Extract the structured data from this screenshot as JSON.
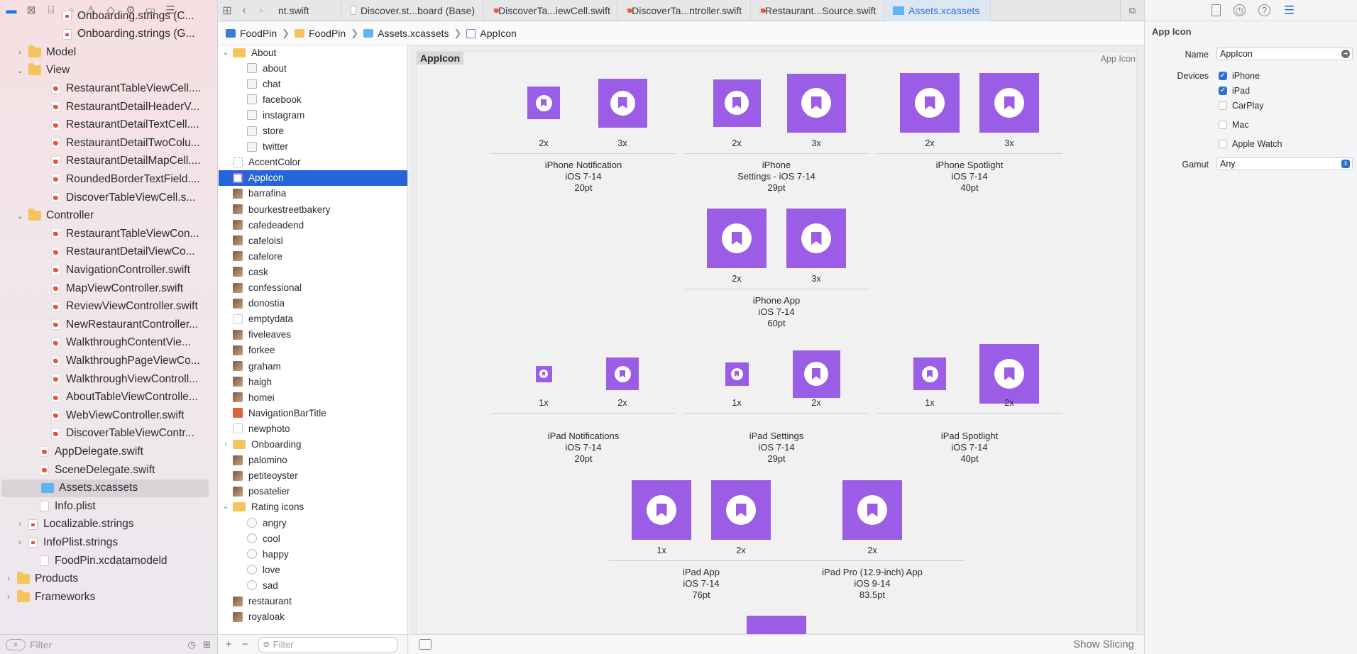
{
  "navigator": {
    "toolbar_icons": [
      "folder-icon",
      "source-control-icon",
      "symbol-icon",
      "find-icon",
      "issue-icon",
      "test-icon",
      "debug-icon",
      "breakpoint-icon",
      "report-icon"
    ],
    "items": [
      {
        "label": "Onboarding.strings (C...",
        "indent": 5,
        "kind": "strings",
        "disclosure": ""
      },
      {
        "label": "Onboarding.strings (G...",
        "indent": 5,
        "kind": "strings",
        "disclosure": ""
      },
      {
        "label": "Model",
        "indent": 2,
        "kind": "folder",
        "disclosure": "›"
      },
      {
        "label": "View",
        "indent": 2,
        "kind": "folder",
        "disclosure": "⌄"
      },
      {
        "label": "RestaurantTableViewCell....",
        "indent": 4,
        "kind": "swift",
        "disclosure": ""
      },
      {
        "label": "RestaurantDetailHeaderV...",
        "indent": 4,
        "kind": "swift",
        "disclosure": ""
      },
      {
        "label": "RestaurantDetailTextCell....",
        "indent": 4,
        "kind": "swift",
        "disclosure": ""
      },
      {
        "label": "RestaurantDetailTwoColu...",
        "indent": 4,
        "kind": "swift",
        "disclosure": ""
      },
      {
        "label": "RestaurantDetailMapCell....",
        "indent": 4,
        "kind": "swift",
        "disclosure": ""
      },
      {
        "label": "RoundedBorderTextField....",
        "indent": 4,
        "kind": "swift",
        "disclosure": ""
      },
      {
        "label": "DiscoverTableViewCell.s...",
        "indent": 4,
        "kind": "swift",
        "disclosure": ""
      },
      {
        "label": "Controller",
        "indent": 2,
        "kind": "folder",
        "disclosure": "⌄"
      },
      {
        "label": "RestaurantTableViewCon...",
        "indent": 4,
        "kind": "swift",
        "disclosure": ""
      },
      {
        "label": "RestaurantDetailViewCo...",
        "indent": 4,
        "kind": "swift",
        "disclosure": ""
      },
      {
        "label": "NavigationController.swift",
        "indent": 4,
        "kind": "swift",
        "disclosure": ""
      },
      {
        "label": "MapViewController.swift",
        "indent": 4,
        "kind": "swift",
        "disclosure": ""
      },
      {
        "label": "ReviewViewController.swift",
        "indent": 4,
        "kind": "swift",
        "disclosure": ""
      },
      {
        "label": "NewRestaurantController...",
        "indent": 4,
        "kind": "swift",
        "disclosure": ""
      },
      {
        "label": "WalkthroughContentVie...",
        "indent": 4,
        "kind": "swift",
        "disclosure": ""
      },
      {
        "label": "WalkthroughPageViewCo...",
        "indent": 4,
        "kind": "swift",
        "disclosure": ""
      },
      {
        "label": "WalkthroughViewControll...",
        "indent": 4,
        "kind": "swift",
        "disclosure": ""
      },
      {
        "label": "AboutTableViewControlle...",
        "indent": 4,
        "kind": "swift",
        "disclosure": ""
      },
      {
        "label": "WebViewController.swift",
        "indent": 4,
        "kind": "swift",
        "disclosure": ""
      },
      {
        "label": "DiscoverTableViewContr...",
        "indent": 4,
        "kind": "swift",
        "disclosure": ""
      },
      {
        "label": "AppDelegate.swift",
        "indent": 3,
        "kind": "swift",
        "disclosure": ""
      },
      {
        "label": "SceneDelegate.swift",
        "indent": 3,
        "kind": "swift",
        "disclosure": ""
      },
      {
        "label": "Assets.xcassets",
        "indent": 3,
        "kind": "assets",
        "disclosure": "",
        "selected": true
      },
      {
        "label": "Info.plist",
        "indent": 3,
        "kind": "plist",
        "disclosure": ""
      },
      {
        "label": "Localizable.strings",
        "indent": 2,
        "kind": "strings",
        "disclosure": "›"
      },
      {
        "label": "InfoPlist.strings",
        "indent": 2,
        "kind": "strings",
        "disclosure": "›"
      },
      {
        "label": "FoodPin.xcdatamodeld",
        "indent": 3,
        "kind": "plist",
        "disclosure": ""
      },
      {
        "label": "Products",
        "indent": 1,
        "kind": "folder",
        "disclosure": "›"
      },
      {
        "label": "Frameworks",
        "indent": 1,
        "kind": "folder",
        "disclosure": "›"
      }
    ],
    "filter_placeholder": "Filter"
  },
  "tabs": {
    "items": [
      {
        "label": "nt.swift",
        "kind": "swift",
        "active": false
      },
      {
        "label": "Discover.st...board (Base)",
        "kind": "storyboard",
        "active": false
      },
      {
        "label": "DiscoverTa...iewCell.swift",
        "kind": "swift",
        "active": false
      },
      {
        "label": "DiscoverTa...ntroller.swift",
        "kind": "swift",
        "active": false
      },
      {
        "label": "Restaurant...Source.swift",
        "kind": "swift",
        "active": false
      },
      {
        "label": "Assets.xcassets",
        "kind": "assets",
        "active": true
      }
    ]
  },
  "jumpbar": {
    "crumbs": [
      "FoodPin",
      "FoodPin",
      "Assets.xcassets",
      "AppIcon"
    ]
  },
  "asset_list": {
    "items": [
      {
        "label": "About",
        "level": 0,
        "thumb": "folder",
        "disclosure": "⌄"
      },
      {
        "label": "about",
        "level": 1,
        "thumb": "set"
      },
      {
        "label": "chat",
        "level": 1,
        "thumb": "set"
      },
      {
        "label": "facebook",
        "level": 1,
        "thumb": "set"
      },
      {
        "label": "instagram",
        "level": 1,
        "thumb": "set"
      },
      {
        "label": "store",
        "level": 1,
        "thumb": "set"
      },
      {
        "label": "twitter",
        "level": 1,
        "thumb": "set"
      },
      {
        "label": "AccentColor",
        "level": 0,
        "thumb": "color"
      },
      {
        "label": "AppIcon",
        "level": 0,
        "thumb": "app",
        "selected": true
      },
      {
        "label": "barrafina",
        "level": 0,
        "thumb": "photo"
      },
      {
        "label": "bourkestreetbakery",
        "level": 0,
        "thumb": "photo"
      },
      {
        "label": "cafedeadend",
        "level": 0,
        "thumb": "photo"
      },
      {
        "label": "cafeloisl",
        "level": 0,
        "thumb": "photo"
      },
      {
        "label": "cafelore",
        "level": 0,
        "thumb": "photo"
      },
      {
        "label": "cask",
        "level": 0,
        "thumb": "photo"
      },
      {
        "label": "confessional",
        "level": 0,
        "thumb": "photo"
      },
      {
        "label": "donostia",
        "level": 0,
        "thumb": "photo"
      },
      {
        "label": "emptydata",
        "level": 0,
        "thumb": "blank"
      },
      {
        "label": "fiveleaves",
        "level": 0,
        "thumb": "photo"
      },
      {
        "label": "forkee",
        "level": 0,
        "thumb": "photo"
      },
      {
        "label": "graham",
        "level": 0,
        "thumb": "photo"
      },
      {
        "label": "haigh",
        "level": 0,
        "thumb": "photo"
      },
      {
        "label": "homei",
        "level": 0,
        "thumb": "photo"
      },
      {
        "label": "NavigationBarTitle",
        "level": 0,
        "thumb": "orange"
      },
      {
        "label": "newphoto",
        "level": 0,
        "thumb": "blank"
      },
      {
        "label": "Onboarding",
        "level": 0,
        "thumb": "folder",
        "disclosure": "›"
      },
      {
        "label": "palomino",
        "level": 0,
        "thumb": "photo"
      },
      {
        "label": "petiteoyster",
        "level": 0,
        "thumb": "photo"
      },
      {
        "label": "posatelier",
        "level": 0,
        "thumb": "photo"
      },
      {
        "label": "Rating icons",
        "level": 0,
        "thumb": "folder",
        "disclosure": "⌄"
      },
      {
        "label": "angry",
        "level": 1,
        "thumb": "rate"
      },
      {
        "label": "cool",
        "level": 1,
        "thumb": "rate"
      },
      {
        "label": "happy",
        "level": 1,
        "thumb": "rate"
      },
      {
        "label": "love",
        "level": 1,
        "thumb": "rate"
      },
      {
        "label": "sad",
        "level": 1,
        "thumb": "rate"
      },
      {
        "label": "restaurant",
        "level": 0,
        "thumb": "photo"
      },
      {
        "label": "royaloak",
        "level": 0,
        "thumb": "photo"
      }
    ],
    "add_label": "+",
    "remove_label": "−",
    "filter_placeholder": "Filter"
  },
  "detail": {
    "set_name": "AppIcon",
    "set_type": "App Icon",
    "groups": [
      {
        "name": "iPhone Notification",
        "os": "iOS 7-14",
        "size": "20pt",
        "scales": [
          "2x",
          "3x"
        ]
      },
      {
        "name": "iPhone",
        "os": "Settings - iOS 7-14",
        "size": "29pt",
        "scales": [
          "2x",
          "3x"
        ]
      },
      {
        "name": "iPhone Spotlight",
        "os": "iOS 7-14",
        "size": "40pt",
        "scales": [
          "2x",
          "3x"
        ]
      },
      {
        "name": "iPhone App",
        "os": "iOS 7-14",
        "size": "60pt",
        "scales": [
          "2x",
          "3x"
        ]
      },
      {
        "name": "iPad Notifications",
        "os": "iOS 7-14",
        "size": "20pt",
        "scales": [
          "1x",
          "2x"
        ]
      },
      {
        "name": "iPad Settings",
        "os": "iOS 7-14",
        "size": "29pt",
        "scales": [
          "1x",
          "2x"
        ]
      },
      {
        "name": "iPad Spotlight",
        "os": "iOS 7-14",
        "size": "40pt",
        "scales": [
          "1x",
          "2x"
        ]
      },
      {
        "name": "iPad App",
        "os": "iOS 7-14",
        "size": "76pt",
        "scales": [
          "1x",
          "2x"
        ]
      },
      {
        "name": "iPad Pro (12.9-inch) App",
        "os": "iOS 9-14",
        "size": "83.5pt",
        "scales": [
          "2x"
        ]
      }
    ],
    "icon_color": "#9b5de5",
    "show_slicing_label": "Show Slicing"
  },
  "inspector": {
    "tabs": [
      "file-icon",
      "history-icon",
      "help-icon",
      "attributes-icon"
    ],
    "title": "App Icon",
    "name_label": "Name",
    "name_value": "AppIcon",
    "devices_label": "Devices",
    "devices": [
      {
        "label": "iPhone",
        "checked": true
      },
      {
        "label": "iPad",
        "checked": true
      },
      {
        "label": "CarPlay",
        "checked": false
      },
      {
        "label": "Mac",
        "checked": false
      },
      {
        "label": "Apple Watch",
        "checked": false
      }
    ],
    "gamut_label": "Gamut",
    "gamut_value": "Any",
    "accent": "#2f6fd1"
  }
}
